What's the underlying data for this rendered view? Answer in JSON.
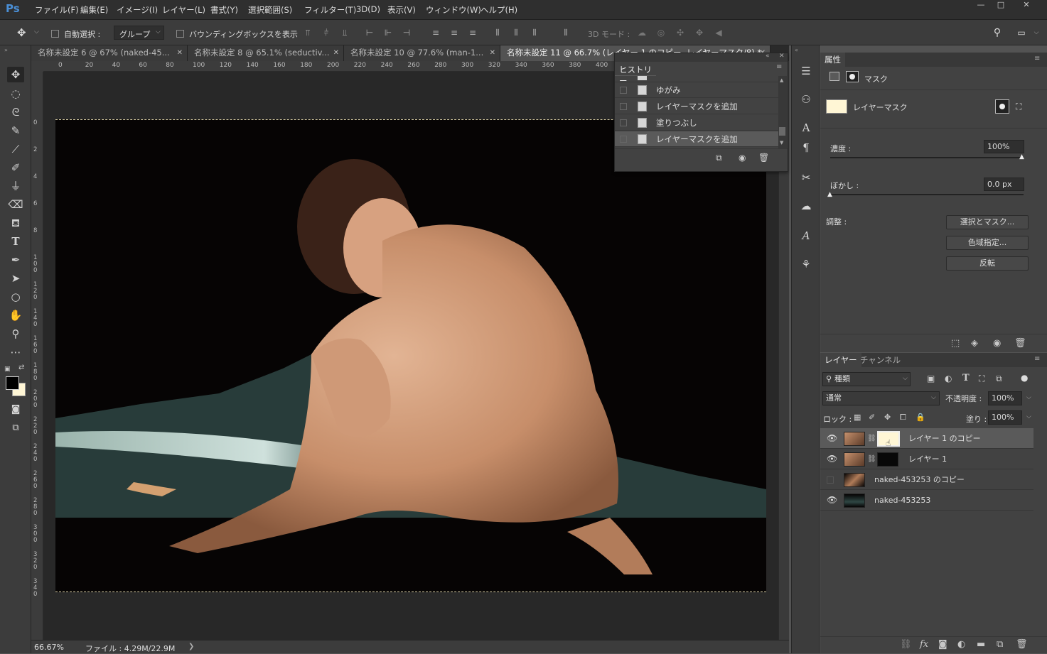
{
  "app": {
    "logo": "Ps"
  },
  "menu": [
    "ファイル(F)",
    "編集(E)",
    "イメージ(I)",
    "レイヤー(L)",
    "書式(Y)",
    "選択範囲(S)",
    "フィルター(T)",
    "3D(D)",
    "表示(V)",
    "ウィンドウ(W)",
    "ヘルプ(H)"
  ],
  "window_controls": {
    "minimize": "—",
    "maximize": "□",
    "close": "✕"
  },
  "options": {
    "auto_select_label": "自動選択 :",
    "auto_select_value": "グループ",
    "bounding_box_label": "バウンディングボックスを表示",
    "mode_3d_label": "3D モード :"
  },
  "tabs": [
    {
      "label": "名称未設定 6 @ 67% (naked-45...",
      "close": "✕"
    },
    {
      "label": "名称未設定 8 @ 65.1% (seductiv...",
      "close": "✕"
    },
    {
      "label": "名称未設定 10 @ 77.6% (man-1...",
      "close": "✕"
    },
    {
      "label": "名称未設定 11 @ 66.7% (レイヤー 1 のコピー, レイヤーマスク/8) *",
      "close": "✕"
    }
  ],
  "ruler_top": [
    "0",
    "20",
    "40",
    "60",
    "80",
    "100",
    "120",
    "140",
    "160",
    "180",
    "200",
    "220",
    "240",
    "260",
    "280",
    "300",
    "320",
    "340",
    "360",
    "380",
    "400"
  ],
  "ruler_left": [
    "0",
    "2",
    "4",
    "6",
    "8",
    "100",
    "120",
    "140",
    "160",
    "180",
    "200",
    "220",
    "240",
    "260",
    "280",
    "300",
    "320",
    "340"
  ],
  "history": {
    "title": "ヒストリー",
    "items": [
      {
        "label": "ゆがみ",
        "selected": false
      },
      {
        "label": "レイヤーマスクを追加",
        "selected": false
      },
      {
        "label": "塗りつぶし",
        "selected": false
      },
      {
        "label": "レイヤーマスクを追加",
        "selected": true
      }
    ]
  },
  "properties": {
    "title": "属性",
    "mask_label": "マスク",
    "layer_mask_label": "レイヤーマスク",
    "density_label": "濃度 :",
    "density_value": "100%",
    "density_level": 1.0,
    "feather_label": "ぼかし :",
    "feather_value": "0.0 px",
    "feather_level": 0.0,
    "adjust_label": "調整 :",
    "btn_select_mask": "選択とマスク...",
    "btn_color_range": "色域指定...",
    "btn_invert": "反転"
  },
  "layers_panel": {
    "tab_layers": "レイヤー",
    "tab_channels": "チャンネル",
    "filter_label": "種類",
    "blend_mode": "通常",
    "opacity_label": "不透明度 :",
    "opacity_value": "100%",
    "lock_label": "ロック :",
    "fill_label": "塗り :",
    "fill_value": "100%",
    "layers": [
      {
        "name": "レイヤー 1 のコピー",
        "visible": true,
        "selected": true,
        "has_mask": true
      },
      {
        "name": "レイヤー 1",
        "visible": true,
        "selected": false,
        "has_mask": true
      },
      {
        "name": "naked-453253 のコピー",
        "visible": false,
        "selected": false,
        "has_mask": false
      },
      {
        "name": "naked-453253",
        "visible": true,
        "selected": false,
        "has_mask": false
      }
    ]
  },
  "status": {
    "zoom": "66.67%",
    "file": "ファイル : 4.29M/22.9M",
    "arrow": "❯"
  },
  "colors": {
    "accent": "#4a8fd6",
    "mask_thumb": "#fff6d5",
    "background": "#535353",
    "panel": "#424242"
  }
}
